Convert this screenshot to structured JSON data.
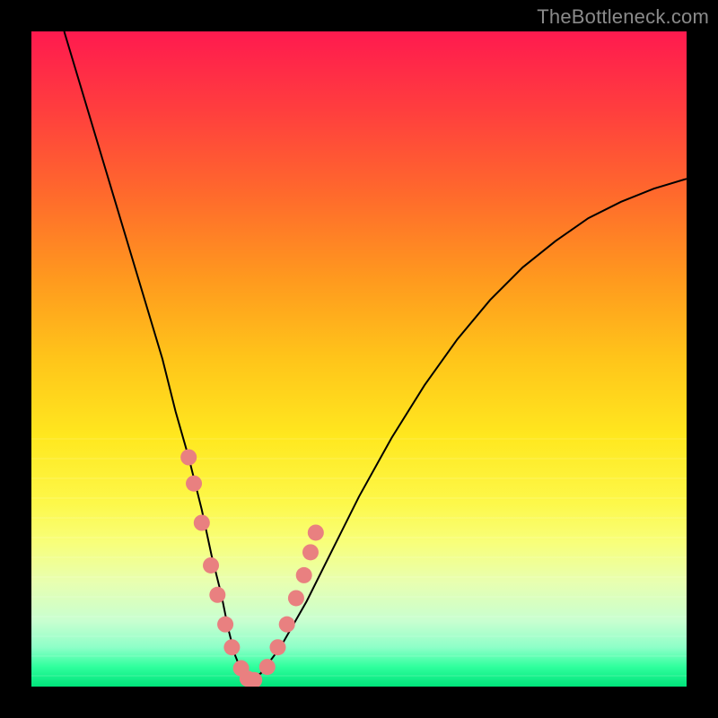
{
  "watermark": {
    "text": "TheBottleneck.com"
  },
  "colors": {
    "dot": "#e98080",
    "curve": "#000000",
    "frame": "#000000"
  },
  "chart_data": {
    "type": "line",
    "title": "",
    "xlabel": "",
    "ylabel": "",
    "xlim": [
      0,
      100
    ],
    "ylim": [
      0,
      100
    ],
    "series": [
      {
        "name": "curve",
        "x": [
          5,
          8,
          11,
          14,
          17,
          20,
          22,
          24,
          26,
          27.5,
          29,
          30,
          31,
          32,
          33,
          35,
          38,
          42,
          46,
          50,
          55,
          60,
          65,
          70,
          75,
          80,
          85,
          90,
          95,
          100
        ],
        "y": [
          100,
          90,
          80,
          70,
          60,
          50,
          42,
          35,
          27,
          20,
          14,
          9,
          5,
          2.5,
          1,
          2,
          6,
          13,
          21,
          29,
          38,
          46,
          53,
          59,
          64,
          68,
          71.5,
          74,
          76,
          77.5
        ]
      }
    ],
    "dots": {
      "name": "highlight-points",
      "x": [
        24.0,
        24.8,
        26.0,
        27.4,
        28.4,
        29.6,
        30.6,
        32.0,
        33.0,
        34.0,
        36.0,
        37.6,
        39.0,
        40.4,
        41.6,
        42.6,
        43.4
      ],
      "y": [
        35.0,
        31.0,
        25.0,
        18.5,
        14.0,
        9.5,
        6.0,
        2.8,
        1.2,
        1.0,
        3.0,
        6.0,
        9.5,
        13.5,
        17.0,
        20.5,
        23.5
      ]
    }
  }
}
